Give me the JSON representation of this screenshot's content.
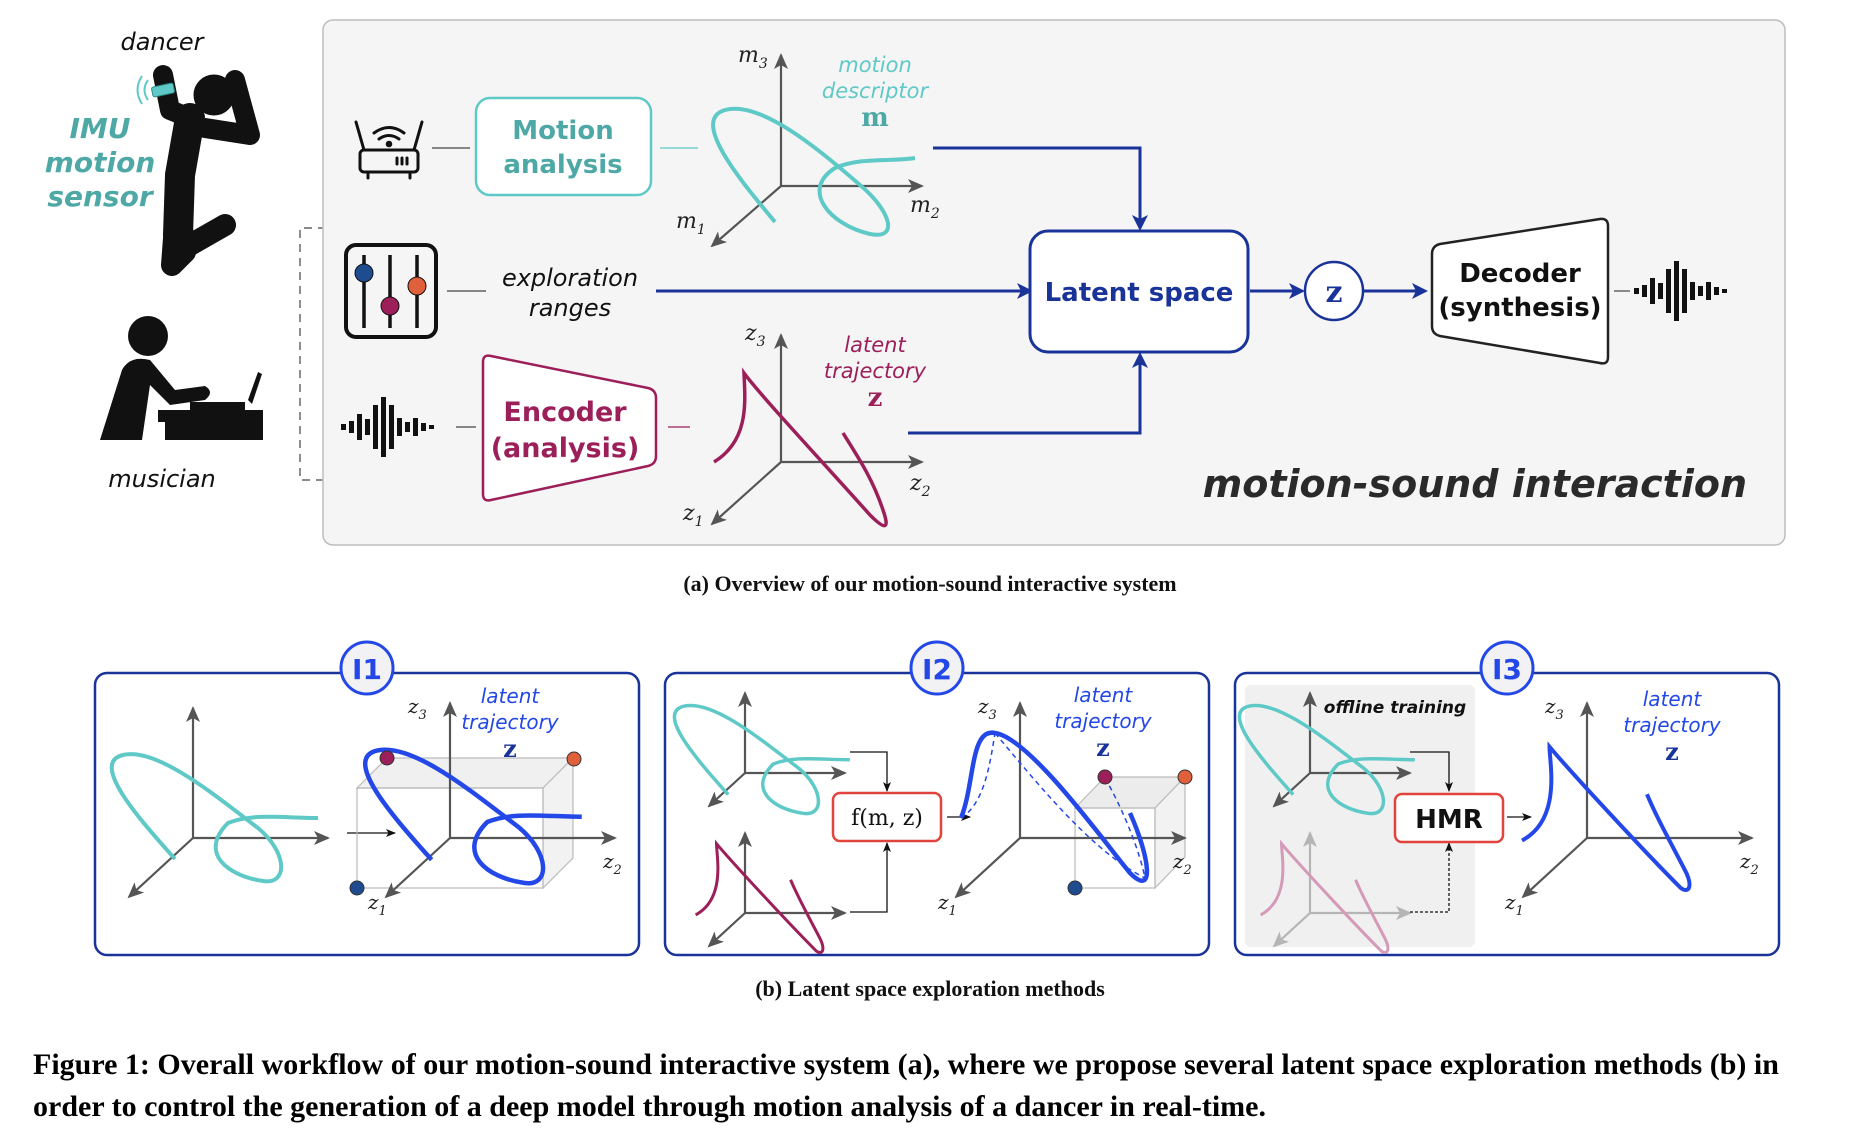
{
  "actors": {
    "dancer_label": "dancer",
    "sensor_label": [
      "IMU",
      "motion",
      "sensor"
    ],
    "musician_label": "musician"
  },
  "panel_a": {
    "motion_analysis": [
      "Motion",
      "analysis"
    ],
    "motion_descriptor": [
      "motion",
      "descriptor",
      "m"
    ],
    "exploration_ranges": [
      "exploration",
      "ranges"
    ],
    "encoder": [
      "Encoder",
      "(analysis)"
    ],
    "latent_trajectory": [
      "latent",
      "trajectory",
      "z"
    ],
    "latent_space": "Latent space",
    "z_node": "z",
    "decoder": [
      "Decoder",
      "(synthesis)"
    ],
    "title": "motion-sound interaction",
    "axes_m": {
      "x": "m",
      "x_sub": "2",
      "y": "m",
      "y_sub": "3",
      "z": "m",
      "z_sub": "1"
    },
    "axes_z": {
      "x": "z",
      "x_sub": "2",
      "y": "z",
      "y_sub": "3",
      "z": "z",
      "z_sub": "1"
    },
    "caption": "(a) Overview of our motion-sound interactive system"
  },
  "panel_b": {
    "methods": [
      {
        "badge": "I1",
        "latent": [
          "latent",
          "trajectory",
          "z"
        ]
      },
      {
        "badge": "I2",
        "latent": [
          "latent",
          "trajectory",
          "z"
        ],
        "function": "f(m, z)"
      },
      {
        "badge": "I3",
        "latent": [
          "latent",
          "trajectory",
          "z"
        ],
        "model": "HMR",
        "offline": "offline training"
      }
    ],
    "axis_labels": {
      "z1": "z",
      "z2": "z",
      "z3": "z",
      "s1": "1",
      "s2": "2",
      "s3": "3"
    },
    "caption": "(b) Latent space exploration methods"
  },
  "figure_caption": "Figure 1: Overall workflow of our motion-sound interactive system (a), where we propose several latent space exploration methods (b) in order to control the generation of a deep model through motion analysis of a dancer in real-time.",
  "colors": {
    "teal": "#5ec9c6",
    "teal_text": "#4ea9a6",
    "maroon": "#9c1f5a",
    "navy": "#1a3399",
    "bright_blue": "#2448e8",
    "red": "#e0443c",
    "slider_blue": "#1f4b8f",
    "slider_orange": "#e0603c",
    "panel_bg": "#f5f5f5"
  }
}
